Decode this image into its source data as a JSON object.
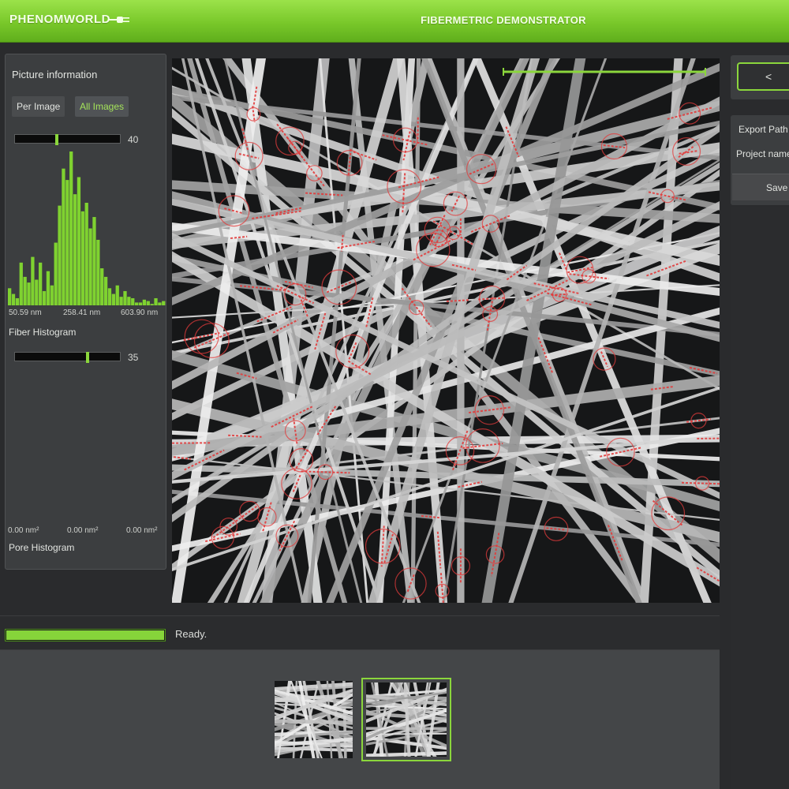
{
  "header": {
    "logo": "PHENOMWORLD",
    "title": "FIBERMETRIC DEMONSTRATOR"
  },
  "left_panel": {
    "section_title": "Picture information",
    "tabs": [
      {
        "label": "Per Image",
        "active": false
      },
      {
        "label": "All Images",
        "active": true
      }
    ],
    "fiber_slider": {
      "value": "40",
      "level": 0.39
    },
    "fiber_histogram": {
      "min_label": "50.59 nm",
      "mid_label": "258.41 nm",
      "max_label": "603.90 nm",
      "title": "Fiber Histogram",
      "counts": [
        12,
        8,
        5,
        30,
        20,
        16,
        34,
        18,
        30,
        10,
        24,
        14,
        44,
        70,
        96,
        88,
        108,
        78,
        90,
        66,
        72,
        54,
        62,
        46,
        26,
        20,
        12,
        8,
        14,
        6,
        10,
        6,
        5,
        2,
        2,
        4,
        3,
        1,
        5,
        2,
        3
      ]
    },
    "pore_slider": {
      "value": "35",
      "level": 0.69
    },
    "pore_histogram": {
      "labels": [
        "0.00 nm²",
        "0.00 nm²",
        "0.00 nm²"
      ],
      "title": "Pore Histogram"
    }
  },
  "right_panel": {
    "back_label": "<",
    "export_path_label": "Export Path",
    "project_name_label": "Project name",
    "save_label": "Save"
  },
  "status": {
    "progress": 1.0,
    "text": "Ready."
  },
  "gallery": {
    "thumbnails": [
      {
        "label": "",
        "selected": false
      },
      {
        "label": "",
        "selected": true
      }
    ]
  },
  "colors": {
    "accent": "#8bd63c",
    "header": "#7cc82c",
    "histogram_bar": "#7fd230",
    "measurement_mark": "#e23b3b"
  },
  "icons": [
    "plug-icon",
    "back-arrow-icon"
  ]
}
